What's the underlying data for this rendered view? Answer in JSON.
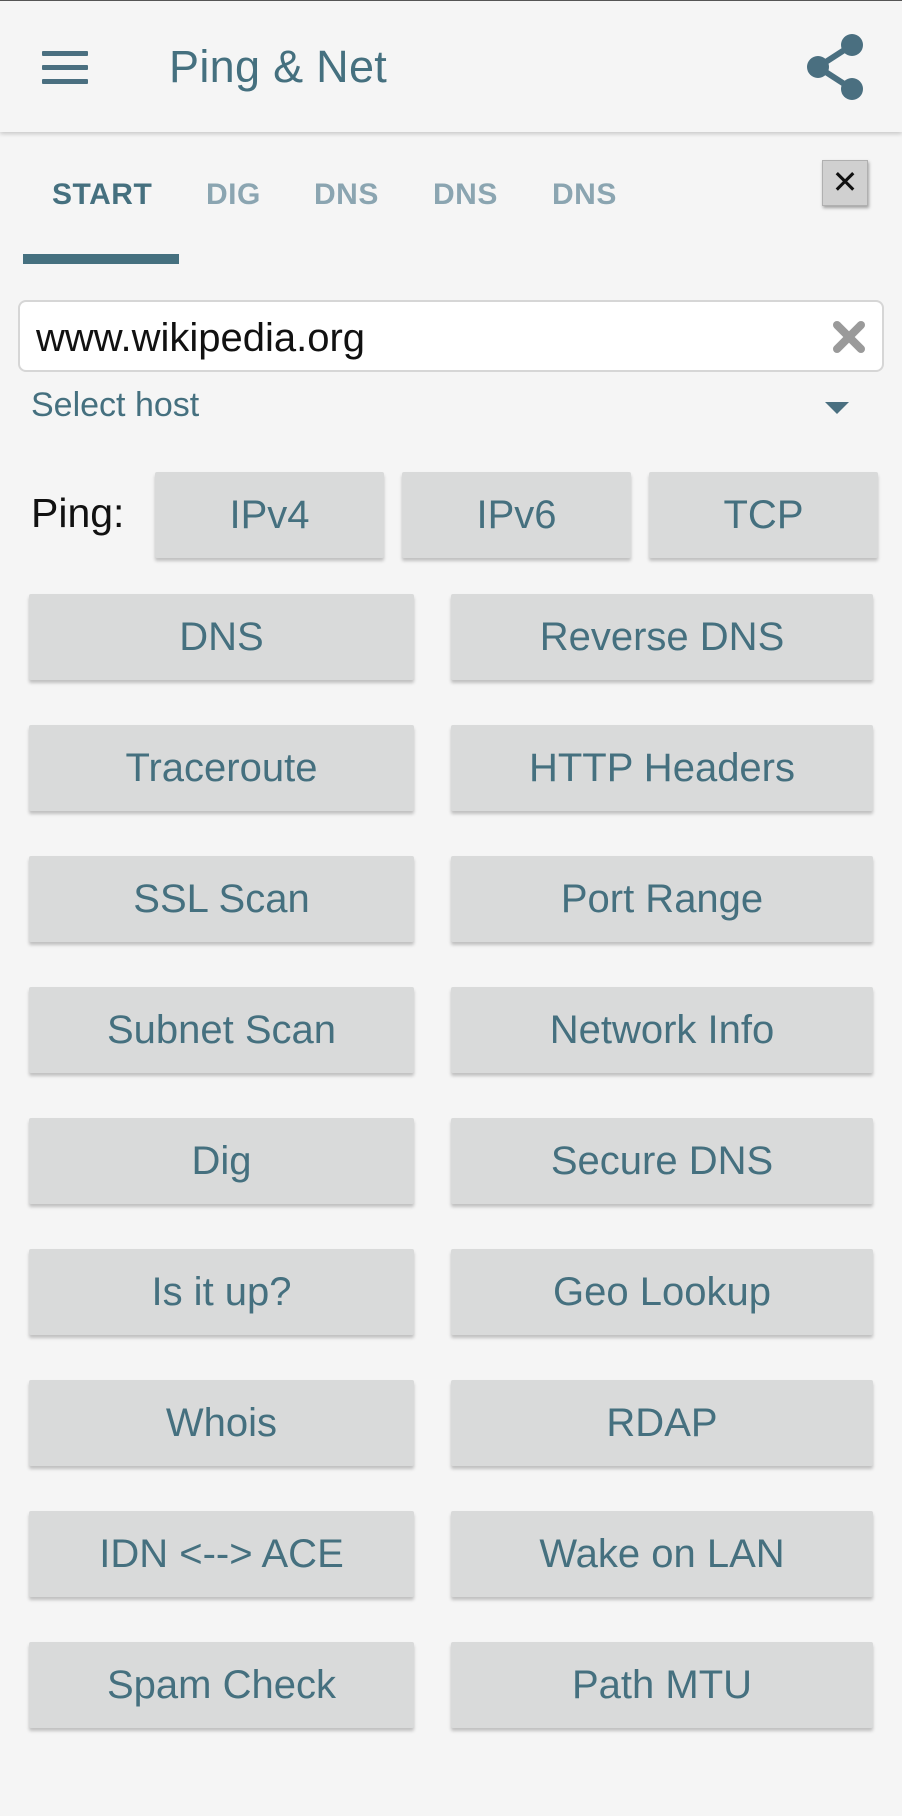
{
  "app_bar": {
    "title": "Ping & Net"
  },
  "tabs": [
    {
      "label": "START",
      "active": true
    },
    {
      "label": "DIG",
      "active": false
    },
    {
      "label": "DNS",
      "active": false
    },
    {
      "label": "DNS",
      "active": false
    },
    {
      "label": "DNS",
      "active": false
    }
  ],
  "tab_close_label": "✕",
  "host": {
    "value": "www.wikipedia.org",
    "select_label": "Select host"
  },
  "ping": {
    "label": "Ping:",
    "buttons": [
      "IPv4",
      "IPv6",
      "TCP"
    ]
  },
  "tools": [
    "DNS",
    "Reverse DNS",
    "Traceroute",
    "HTTP Headers",
    "SSL Scan",
    "Port Range",
    "Subnet Scan",
    "Network Info",
    "Dig",
    "Secure DNS",
    "Is it up?",
    "Geo Lookup",
    "Whois",
    "RDAP",
    "IDN <--> ACE",
    "Wake on LAN",
    "Spam Check",
    "Path MTU"
  ],
  "colors": {
    "accent": "#45707f",
    "button_bg": "#d9dada",
    "background": "#f5f5f5"
  }
}
